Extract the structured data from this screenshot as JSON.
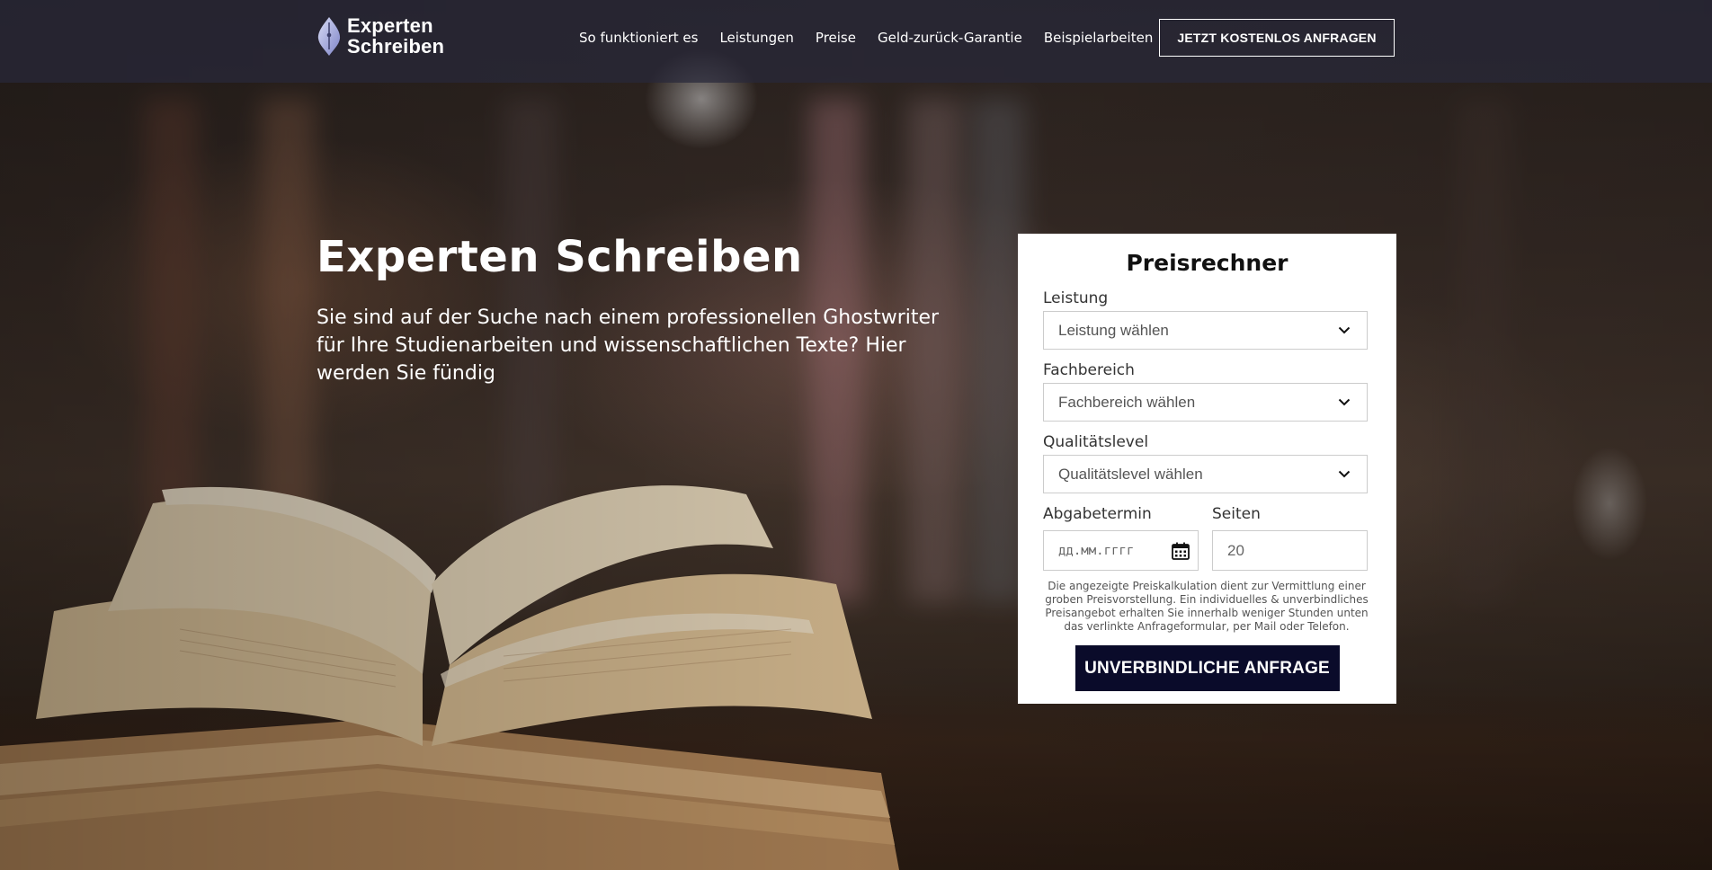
{
  "brand": {
    "line1": "Experten",
    "line2": "Schreiben"
  },
  "nav": {
    "items": [
      "So funktioniert es",
      "Leistungen",
      "Preise",
      "Geld-zurück-Garantie",
      "Beispielarbeiten"
    ],
    "cta_label": "JETZT KOSTENLOS ANFRAGEN"
  },
  "hero": {
    "title": "Experten Schreiben",
    "subtitle": "Sie sind auf der Suche nach einem professionellen Ghostwriter für Ihre Studienarbeiten und wissenschaftlichen Texte? Hier werden Sie fündig"
  },
  "calculator": {
    "title": "Preisrechner",
    "leistung_label": "Leistung",
    "leistung_value": "Leistung wählen",
    "fachbereich_label": "Fachbereich",
    "fachbereich_value": "Fachbereich wählen",
    "qualitaet_label": "Qualitätslevel",
    "qualitaet_value": "Qualitätslevel wählen",
    "abgabe_label": "Abgabetermin",
    "abgabe_placeholder": "дд.мм.гггг",
    "seiten_label": "Seiten",
    "seiten_value": "20",
    "disclaimer": "Die angezeigte Preiskalkulation dient zur Vermittlung einer groben Preisvorstellung. Ein individuelles & unverbindliches Preisangebot erhalten Sie innerhalb weniger Stunden unten das verlinkte Anfrageformular, per Mail oder Telefon.",
    "submit_label": "UNVERBINDLICHE ANFRAGE"
  },
  "colors": {
    "header_bg": "#28283a",
    "submit_bg": "#0a0b2a",
    "panel_bg": "#ffffff"
  },
  "icons": {
    "logo": "fountain-pen-nib-icon",
    "select_chevron": "chevron-down-icon",
    "date_picker": "calendar-icon"
  }
}
